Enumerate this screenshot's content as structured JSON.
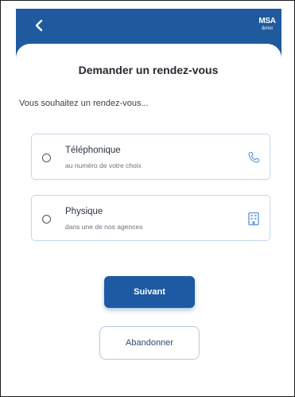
{
  "header": {
    "back_icon": "chevron-left-icon",
    "logo_line1": "MSA",
    "logo_line2": "&moi"
  },
  "page": {
    "title": "Demander un rendez-vous",
    "subtitle": "Vous souhaitez un rendez-vous..."
  },
  "options": [
    {
      "title": "Téléphonique",
      "description": "au numéro de votre choix",
      "icon": "phone-icon",
      "selected": false
    },
    {
      "title": "Physique",
      "description": "dans une de nos agences",
      "icon": "building-icon",
      "selected": false
    }
  ],
  "actions": {
    "next_label": "Suivant",
    "cancel_label": "Abandonner"
  },
  "colors": {
    "primary": "#1f5a9e",
    "button_primary": "#1d5aa3",
    "option_border": "#c7d6ea",
    "icon_accent": "#6ea2dc"
  }
}
